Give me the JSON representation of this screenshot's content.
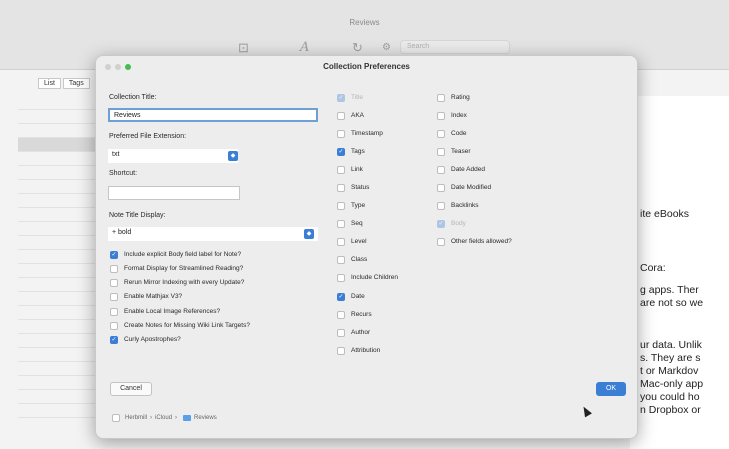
{
  "app": {
    "window_title": "Reviews",
    "toolbar_icons": [
      "sidebar-icon",
      "font-icon",
      "refresh-icon",
      "gear-icon"
    ],
    "search_placeholder": "Search",
    "left_tabs": [
      "List",
      "Tags"
    ],
    "right_lines": [
      "ite eBooks",
      "Cora:",
      "g apps. Ther",
      "are not so we",
      "ur data. Unlik",
      "s. They are s",
      "t or Markdov",
      "Mac-only app",
      "you could ho",
      "n Dropbox or"
    ]
  },
  "dialog": {
    "title": "Collection Preferences",
    "collection_title_label": "Collection Title:",
    "collection_title_value": "Reviews",
    "file_ext_label": "Preferred File Extension:",
    "file_ext_value": "txt",
    "shortcut_label": "Shortcut:",
    "shortcut_value": "",
    "note_title_label": "Note Title Display:",
    "note_title_value": "+ bold",
    "options": [
      {
        "label": "Include explicit Body field label for Note?",
        "checked": true
      },
      {
        "label": "Format Display for Streamlined Reading?",
        "checked": false
      },
      {
        "label": "Rerun Mirror Indexing with every Update?",
        "checked": false
      },
      {
        "label": "Enable Mathjax V3?",
        "checked": false
      },
      {
        "label": "Enable Local Image References?",
        "checked": false
      },
      {
        "label": "Create Notes for Missing Wiki Link Targets?",
        "checked": false
      },
      {
        "label": "Curly Apostrophes?",
        "checked": true
      }
    ],
    "fields_col1": [
      {
        "label": "Title",
        "checked": true,
        "disabled": true
      },
      {
        "label": "AKA",
        "checked": false
      },
      {
        "label": "Timestamp",
        "checked": false
      },
      {
        "label": "Tags",
        "checked": true
      },
      {
        "label": "Link",
        "checked": false
      },
      {
        "label": "Status",
        "checked": false
      },
      {
        "label": "Type",
        "checked": false
      },
      {
        "label": "Seq",
        "checked": false
      },
      {
        "label": "Level",
        "checked": false
      },
      {
        "label": "Class",
        "checked": false
      },
      {
        "label": "Include Children",
        "checked": false
      },
      {
        "label": "Date",
        "checked": true
      },
      {
        "label": "Recurs",
        "checked": false
      },
      {
        "label": "Author",
        "checked": false
      },
      {
        "label": "Attribution",
        "checked": false
      }
    ],
    "fields_col2": [
      {
        "label": "Rating",
        "checked": false
      },
      {
        "label": "Index",
        "checked": false
      },
      {
        "label": "Code",
        "checked": false
      },
      {
        "label": "Teaser",
        "checked": false
      },
      {
        "label": "Date Added",
        "checked": false
      },
      {
        "label": "Date Modified",
        "checked": false
      },
      {
        "label": "Backlinks",
        "checked": false
      },
      {
        "label": "Body",
        "checked": true,
        "disabled": true
      },
      {
        "label": "Other fields allowed?",
        "checked": false
      }
    ],
    "cancel_label": "Cancel",
    "ok_label": "OK",
    "footer_path": {
      "root": "Herbmill",
      "middle": "iCloud",
      "folder": "Reviews"
    }
  }
}
